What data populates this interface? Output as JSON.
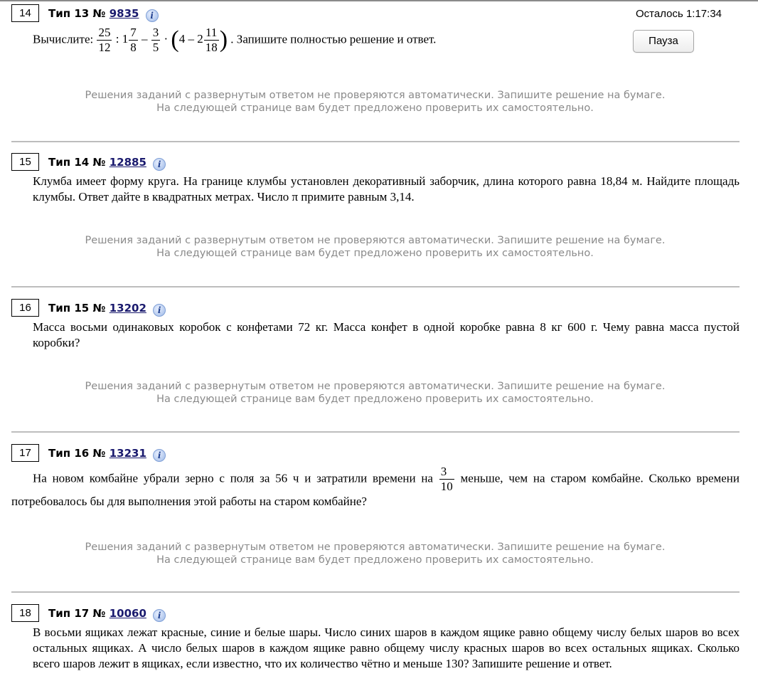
{
  "timer": "Осталось 1:17:34",
  "pause_label": "Пауза",
  "note_line1": "Решения заданий с развернутым ответом не проверяются автоматически. Запишите решение на бумаге.",
  "note_line2": "На следующей странице вам будет предложено проверить их самостоятельно.",
  "tasks": [
    {
      "num": "14",
      "type_label": "Тип 13 №",
      "id": "9835",
      "text_before": "Вычислите:",
      "text_after": ". Запишите полностью решение и ответ.",
      "expr": {
        "f1n": "25",
        "f1d": "12",
        "colon": ":",
        "m1whole": "1",
        "m1n": "7",
        "m1d": "8",
        "minus": "–",
        "f2n": "3",
        "f2d": "5",
        "dot": "·",
        "open": "(",
        "four": "4",
        "minus2": "–",
        "m2whole": "2",
        "m2n": "11",
        "m2d": "18",
        "close": ")"
      }
    },
    {
      "num": "15",
      "type_label": "Тип 14 №",
      "id": "12885",
      "text": "Клумба имеет форму круга. На границе клумбы установлен декоративный заборчик, длина которого равна 18,84 м. Найдите площадь клумбы. Ответ дайте в квадратных метрах. Число  π  примите равным 3,14."
    },
    {
      "num": "16",
      "type_label": "Тип 15 №",
      "id": "13202",
      "text": "Масса восьми одинаковых коробок с конфетами 72 кг. Масса конфет в одной коробке равна 8 кг 600 г. Чему равна масса пустой коробки?"
    },
    {
      "num": "17",
      "type_label": "Тип 16 №",
      "id": "13231",
      "text_before": "На новом комбайне убрали зерно с поля за 56 ч и затратили времени на",
      "frac_n": "3",
      "frac_d": "10",
      "text_mid": "меньше, чем на старом комбайне. Сколько времени",
      "text_after": "потребовалось бы для выполнения этой работы на старом комбайне?"
    },
    {
      "num": "18",
      "type_label": "Тип 17 №",
      "id": "10060",
      "text": "В восьми ящиках лежат красные, синие и белые шары. Число синих шаров в каждом ящике равно общему числу белых шаров во всех остальных ящиках. А число белых шаров в каждом ящике равно общему числу красных шаров во всех остальных ящиках. Сколько всего шаров лежит в ящиках, если известно, что их количество чётно и меньше 130? Запишите решение и ответ."
    }
  ]
}
